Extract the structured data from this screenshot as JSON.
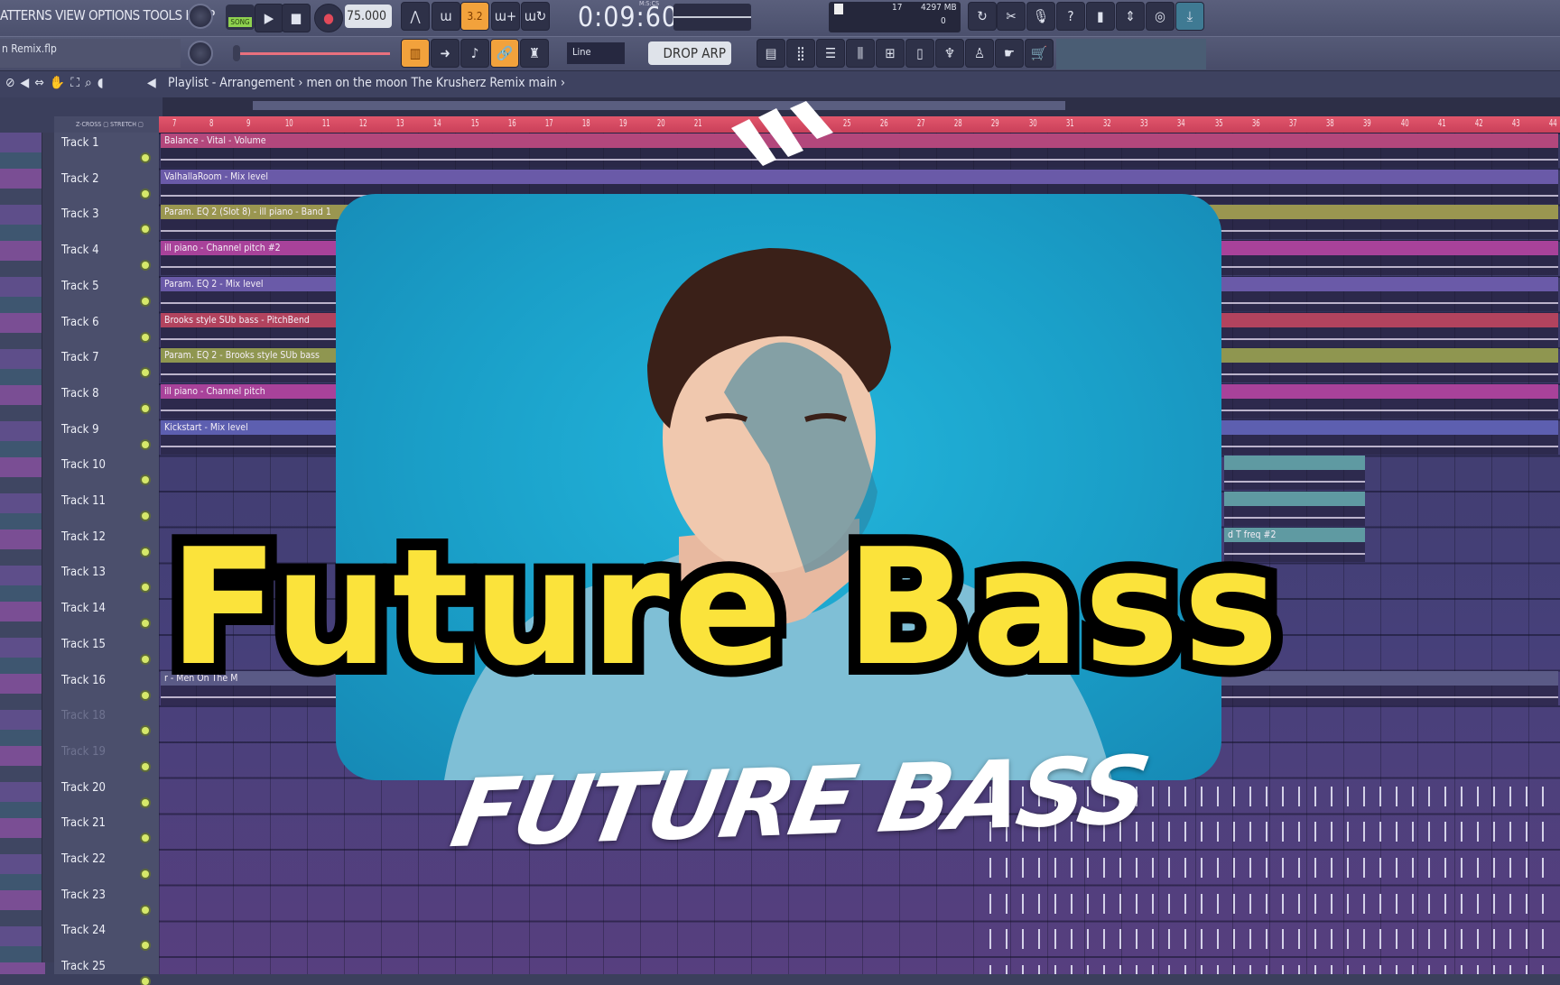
{
  "toolbar": {
    "menu": "ATTERNS VIEW OPTIONS TOOLS HELP",
    "song_mode": "SONG",
    "tempo": "75.000",
    "time": "0:09:60",
    "time_unit": "M:S:CS",
    "cpu_value": "17",
    "memory": "4297 MB",
    "polyphony": "0",
    "project_file": "n Remix.flp",
    "snap_mode": "Line",
    "pattern": "DROP ARP",
    "accent_color": "#f2a23c"
  },
  "breadcrumb": {
    "title": "Playlist - Arrangement",
    "separator": "›",
    "item": "men on the moon The Krusherz Remix main"
  },
  "ruler": {
    "zcross": "Z-CROSS",
    "stretch": "STRETCH",
    "bars": [
      "7",
      "8",
      "9",
      "10",
      "11",
      "12",
      "13",
      "14",
      "15",
      "16",
      "17",
      "18",
      "19",
      "20",
      "21",
      "25",
      "26",
      "27",
      "28",
      "29",
      "30",
      "31",
      "32",
      "33",
      "34",
      "35",
      "36",
      "37",
      "38",
      "39",
      "40",
      "41",
      "42",
      "43",
      "44"
    ],
    "color": "#d44a62"
  },
  "tracks": [
    {
      "name": "Track 1",
      "clip": "Balance - Vital - Volume",
      "color": "#b3477c"
    },
    {
      "name": "Track 2",
      "clip": "ValhallaRoom - Mix level",
      "color": "#6a5aa8"
    },
    {
      "name": "Track 3",
      "clip": "Param. EQ 2 (Slot 8) - ill piano - Band 1",
      "color": "#9a9650"
    },
    {
      "name": "Track 4",
      "clip": "ill piano - Channel pitch #2",
      "color": "#a8429a"
    },
    {
      "name": "Track 5",
      "clip": "Param. EQ 2 - Mix level",
      "color": "#6a5aa8"
    },
    {
      "name": "Track 6",
      "clip": "Brooks style SUb bass - PitchBend",
      "color": "#b2435e"
    },
    {
      "name": "Track 7",
      "clip": "Param. EQ 2 - Brooks style SUb bass",
      "color": "#8f9650"
    },
    {
      "name": "Track 8",
      "clip": "ill piano - Channel pitch",
      "color": "#a8429a"
    },
    {
      "name": "Track 9",
      "clip": "Kickstart - Mix level",
      "color": "#5d5fb0"
    },
    {
      "name": "Track 10",
      "clip": "",
      "color": "#5f9aa2"
    },
    {
      "name": "Track 11",
      "clip": "",
      "color": "#5f9aa2"
    },
    {
      "name": "Track 12",
      "clip": "d T freq #2",
      "color": "#5f9aa2"
    },
    {
      "name": "Track 13",
      "clip": "",
      "color": ""
    },
    {
      "name": "Track 14",
      "clip": "",
      "color": ""
    },
    {
      "name": "Track 15",
      "clip": "",
      "color": ""
    },
    {
      "name": "Track 16",
      "clip": "r - Men On The M",
      "color": "#5a5a86"
    },
    {
      "name": "Track 18",
      "clip": "",
      "color": "",
      "dim": true
    },
    {
      "name": "Track 19",
      "clip": "",
      "color": "",
      "dim": true
    },
    {
      "name": "Track 20",
      "clip": "",
      "color": ""
    },
    {
      "name": "Track 21",
      "clip": "",
      "color": ""
    },
    {
      "name": "Track 22",
      "clip": "",
      "color": ""
    },
    {
      "name": "Track 23",
      "clip": "",
      "color": ""
    },
    {
      "name": "Track 24",
      "clip": "",
      "color": ""
    },
    {
      "name": "Track 25",
      "clip": "",
      "color": ""
    }
  ],
  "overlay": {
    "title": "Future Bass",
    "title_color": "#fbe33b",
    "brush_logo": "FUTURE BASS",
    "card_color": "#1a9fc8"
  }
}
